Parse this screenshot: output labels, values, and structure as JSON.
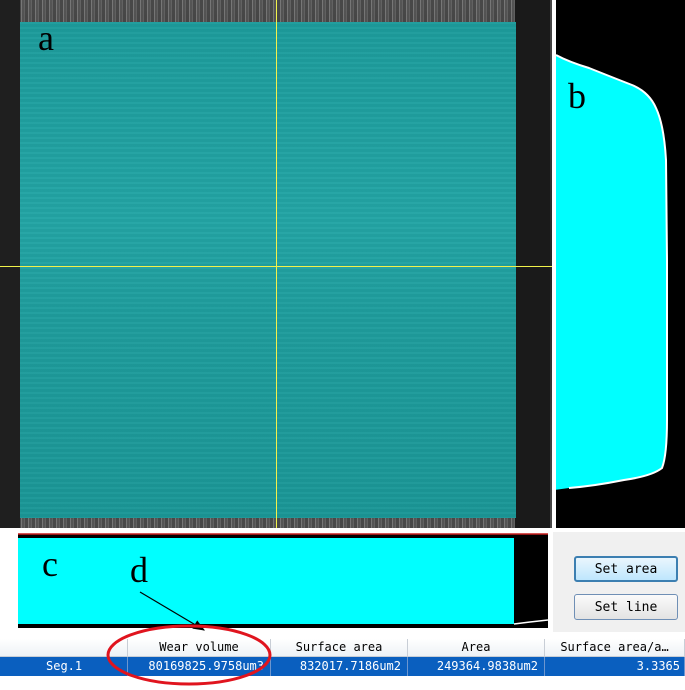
{
  "labels": {
    "a": "a",
    "b": "b",
    "c": "c",
    "d": "d"
  },
  "buttons": {
    "set_area": "Set area",
    "set_line": "Set line"
  },
  "table": {
    "headers": [
      "",
      "Wear volume",
      "Surface area",
      "Area",
      "Surface area/a…"
    ],
    "rows": [
      [
        "Seg.1",
        "80169825.9758um3",
        "832017.7186um2",
        "249364.9838um2",
        "3.3365"
      ]
    ]
  },
  "colors": {
    "roi_fill": "#1fa0a0",
    "profile_fill": "#00ffff",
    "crosshair": "#f2f24a",
    "highlight_ellipse": "#e0141e",
    "selected_row": "#0a5fbf"
  }
}
